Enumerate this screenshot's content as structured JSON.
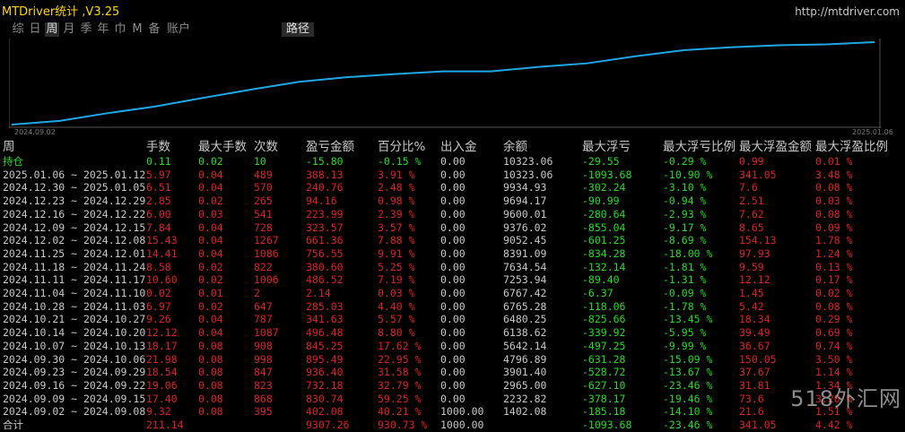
{
  "header": {
    "title": "MTDriver统计 ,V3.25",
    "url": "http://mtdriver.com",
    "tabs": [
      "综",
      "日",
      "周",
      "月",
      "季",
      "年",
      "巾",
      "M",
      "备",
      "账户"
    ],
    "active_tab": 2,
    "path_tab": "路径"
  },
  "chart_data": {
    "type": "line",
    "x_start": "2024.09.02",
    "x_end": "2025.01.06",
    "x": [
      "2024.09.02",
      "2024.09.09",
      "2024.09.16",
      "2024.09.23",
      "2024.09.30",
      "2024.10.07",
      "2024.10.14",
      "2024.10.21",
      "2024.10.28",
      "2024.11.04",
      "2024.11.11",
      "2024.11.18",
      "2024.11.25",
      "2024.12.02",
      "2024.12.09",
      "2024.12.16",
      "2024.12.23",
      "2024.12.30",
      "2025.01.06"
    ],
    "values": [
      1000.0,
      1402.08,
      2232.82,
      2965.0,
      3901.4,
      4796.89,
      5642.14,
      6138.62,
      6480.25,
      6765.28,
      6767.42,
      7253.94,
      7634.54,
      8391.09,
      9052.45,
      9376.02,
      9600.01,
      9694.17,
      9934.93
    ],
    "color": "#1ea7e6"
  },
  "table": {
    "headers": [
      "周",
      "手数",
      "最大手数",
      "次数",
      "盈亏金额",
      "百分比%",
      "出入金",
      "余额",
      "最大浮亏",
      "最大浮亏比例",
      "最大浮盈金额",
      "最大浮盈比例"
    ],
    "rows": [
      [
        "持仓",
        "0.11",
        "0.02",
        "10",
        "-15.80",
        "-0.15 %",
        "0.00",
        "10323.06",
        "-29.55",
        "-0.29 %",
        "0.99",
        "0.01 %"
      ],
      [
        "2025.01.06 ~ 2025.01.12",
        "5.97",
        "0.04",
        "489",
        "388.13",
        "3.91 %",
        "0.00",
        "10323.06",
        "-1093.68",
        "-10.90 %",
        "341.05",
        "3.48 %"
      ],
      [
        "2024.12.30 ~ 2025.01.05",
        "6.51",
        "0.04",
        "570",
        "240.76",
        "2.48 %",
        "0.00",
        "9934.93",
        "-302.24",
        "-3.10 %",
        "7.6",
        "0.08 %"
      ],
      [
        "2024.12.23 ~ 2024.12.29",
        "2.85",
        "0.02",
        "265",
        "94.16",
        "0.98 %",
        "0.00",
        "9694.17",
        "-90.99",
        "-0.94 %",
        "2.51",
        "0.03 %"
      ],
      [
        "2024.12.16 ~ 2024.12.22",
        "6.00",
        "0.03",
        "541",
        "223.99",
        "2.39 %",
        "0.00",
        "9600.01",
        "-280.64",
        "-2.93 %",
        "7.62",
        "0.08 %"
      ],
      [
        "2024.12.09 ~ 2024.12.15",
        "7.84",
        "0.04",
        "728",
        "323.57",
        "3.57 %",
        "0.00",
        "9376.02",
        "-855.04",
        "-9.17 %",
        "8.65",
        "0.09 %"
      ],
      [
        "2024.12.02 ~ 2024.12.08",
        "15.43",
        "0.04",
        "1267",
        "661.36",
        "7.88 %",
        "0.00",
        "9052.45",
        "-601.25",
        "-8.69 %",
        "154.13",
        "1.78 %"
      ],
      [
        "2024.11.25 ~ 2024.12.01",
        "14.41",
        "0.04",
        "1086",
        "756.55",
        "9.91 %",
        "0.00",
        "8391.09",
        "-834.28",
        "-18.00 %",
        "97.93",
        "1.24 %"
      ],
      [
        "2024.11.18 ~ 2024.11.24",
        "8.58",
        "0.02",
        "822",
        "380.60",
        "5.25 %",
        "0.00",
        "7634.54",
        "-132.14",
        "-1.81 %",
        "9.59",
        "0.13 %"
      ],
      [
        "2024.11.11 ~ 2024.11.17",
        "10.60",
        "0.02",
        "1006",
        "486.52",
        "7.19 %",
        "0.00",
        "7253.94",
        "-89.40",
        "-1.31 %",
        "12.12",
        "0.17 %"
      ],
      [
        "2024.11.04 ~ 2024.11.10",
        "0.02",
        "0.01",
        "2",
        "2.14",
        "0.03 %",
        "0.00",
        "6767.42",
        "-6.37",
        "-0.09 %",
        "1.45",
        "0.02 %"
      ],
      [
        "2024.10.28 ~ 2024.11.03",
        "6.97",
        "0.02",
        "647",
        "285.03",
        "4.40 %",
        "0.00",
        "6765.28",
        "-118.06",
        "-1.78 %",
        "5.42",
        "0.08 %"
      ],
      [
        "2024.10.21 ~ 2024.10.27",
        "9.26",
        "0.04",
        "787",
        "341.63",
        "5.57 %",
        "0.00",
        "6480.25",
        "-825.66",
        "-13.45 %",
        "18.34",
        "0.29 %"
      ],
      [
        "2024.10.14 ~ 2024.10.20",
        "12.12",
        "0.04",
        "1087",
        "496.48",
        "8.80 %",
        "0.00",
        "6138.62",
        "-339.92",
        "-5.95 %",
        "39.49",
        "0.69 %"
      ],
      [
        "2024.10.07 ~ 2024.10.13",
        "18.17",
        "0.08",
        "908",
        "845.25",
        "17.62 %",
        "0.00",
        "5642.14",
        "-497.25",
        "-9.99 %",
        "36.67",
        "0.74 %"
      ],
      [
        "2024.09.30 ~ 2024.10.06",
        "21.98",
        "0.08",
        "998",
        "895.49",
        "22.95 %",
        "0.00",
        "4796.89",
        "-631.28",
        "-15.09 %",
        "150.05",
        "3.50 %"
      ],
      [
        "2024.09.23 ~ 2024.09.29",
        "18.54",
        "0.08",
        "847",
        "936.40",
        "31.58 %",
        "0.00",
        "3901.40",
        "-528.72",
        "-13.67 %",
        "37.67",
        "1.14 %"
      ],
      [
        "2024.09.16 ~ 2024.09.22",
        "19.06",
        "0.08",
        "823",
        "732.18",
        "32.79 %",
        "0.00",
        "2965.00",
        "-627.10",
        "-23.46 %",
        "31.81",
        "1.34 %"
      ],
      [
        "2024.09.09 ~ 2024.09.15",
        "17.40",
        "0.08",
        "868",
        "830.74",
        "59.25 %",
        "0.00",
        "2232.82",
        "-378.17",
        "-19.46 %",
        "73.6",
        "3.20 %"
      ],
      [
        "2024.09.02 ~ 2024.09.08",
        "9.32",
        "0.08",
        "395",
        "402.08",
        "40.21 %",
        "1000.00",
        "1402.08",
        "-185.18",
        "-14.10 %",
        "21.6",
        "1.51 %"
      ]
    ],
    "total": [
      "合计",
      "211.14",
      "",
      "",
      "9307.26",
      "930.73 %",
      "1000.00",
      "",
      "-1093.68",
      "-23.46 %",
      "341.05",
      "4.42 %"
    ],
    "colors": {
      "text": "#c8c8c8",
      "positive": "#e02020",
      "negative": "#22dd22"
    }
  },
  "watermark": "518外汇网"
}
